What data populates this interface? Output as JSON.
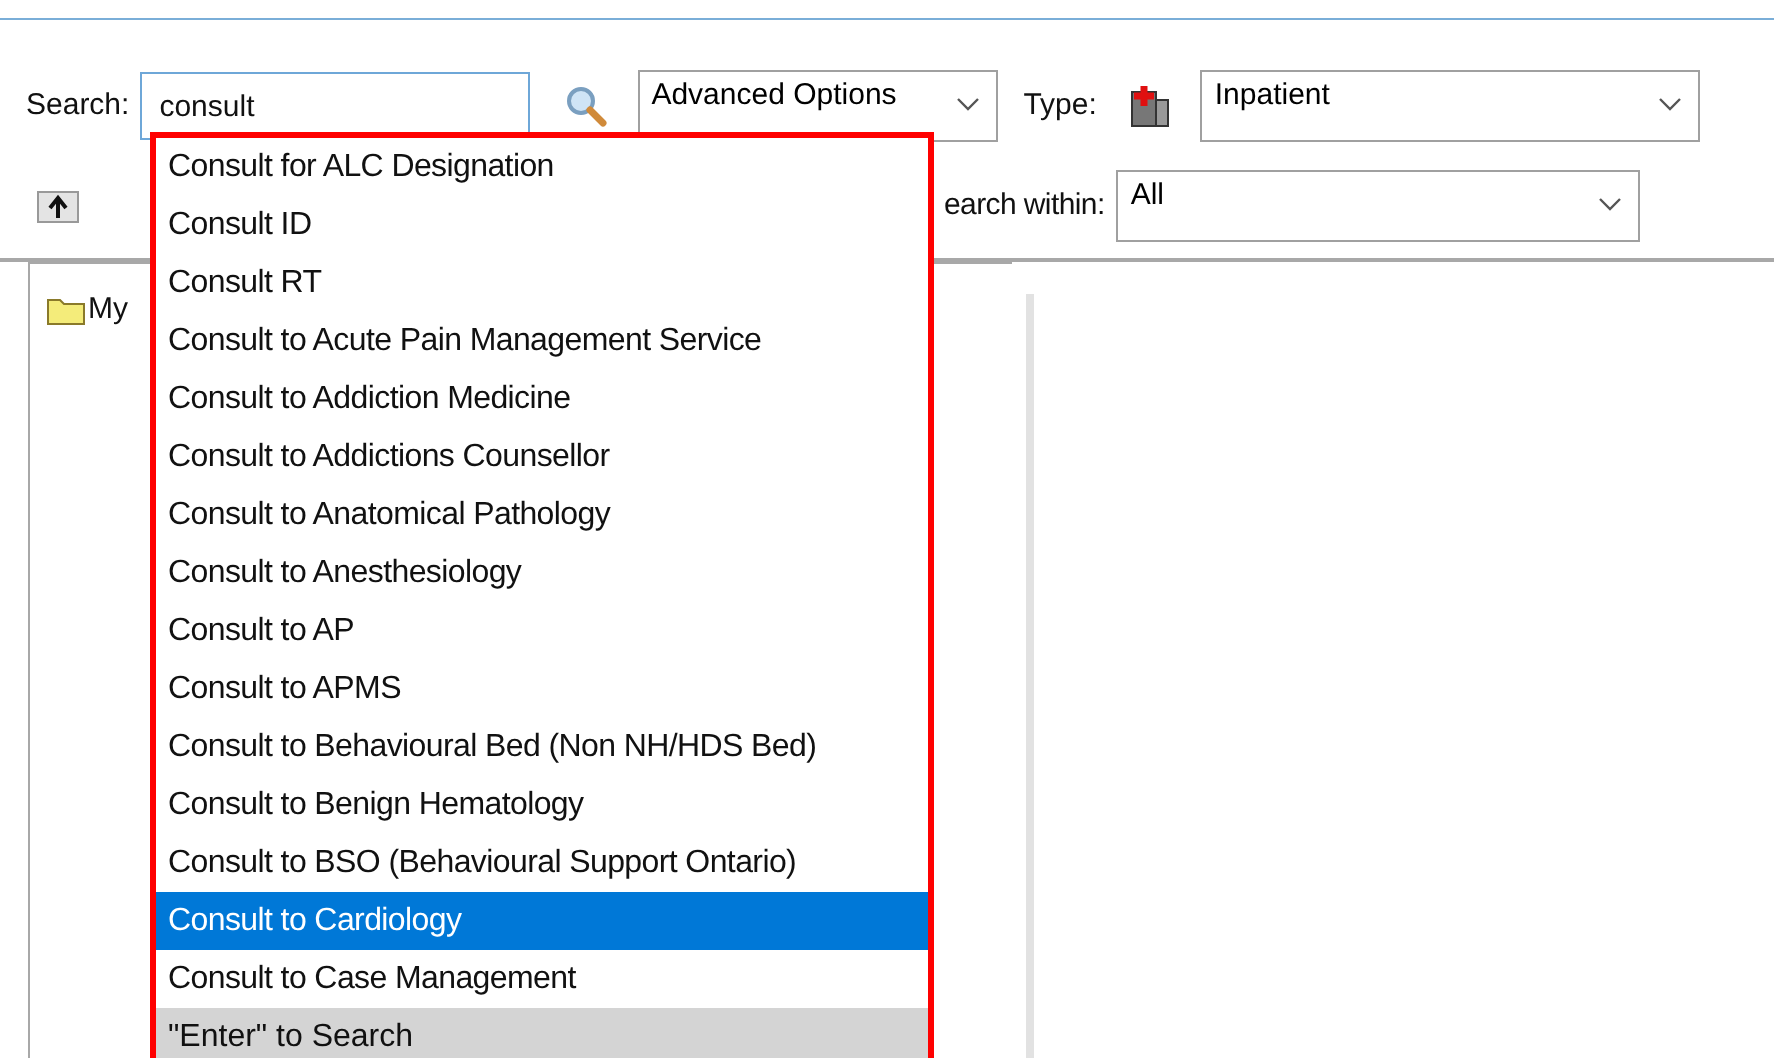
{
  "search": {
    "label": "Search:",
    "value": "consult"
  },
  "advanced_options": {
    "value": "Advanced Options"
  },
  "type": {
    "label": "Type:",
    "value": "Inpatient"
  },
  "search_within": {
    "label": "earch within:",
    "value": "All"
  },
  "tree": {
    "items": [
      {
        "label": "My"
      }
    ]
  },
  "suggestions": {
    "items": [
      {
        "label": "Consult for ALC Designation",
        "selected": false
      },
      {
        "label": "Consult ID",
        "selected": false
      },
      {
        "label": "Consult RT",
        "selected": false
      },
      {
        "label": "Consult to Acute Pain Management Service",
        "selected": false
      },
      {
        "label": "Consult to Addiction Medicine",
        "selected": false
      },
      {
        "label": "Consult to Addictions Counsellor",
        "selected": false
      },
      {
        "label": "Consult to Anatomical Pathology",
        "selected": false
      },
      {
        "label": "Consult to Anesthesiology",
        "selected": false
      },
      {
        "label": "Consult to AP",
        "selected": false
      },
      {
        "label": "Consult to APMS",
        "selected": false
      },
      {
        "label": "Consult to Behavioural Bed (Non NH/HDS Bed)",
        "selected": false
      },
      {
        "label": "Consult to Benign Hematology",
        "selected": false
      },
      {
        "label": "Consult to BSO (Behavioural Support Ontario)",
        "selected": false
      },
      {
        "label": "Consult to Cardiology",
        "selected": true
      },
      {
        "label": "Consult to Case Management",
        "selected": false
      }
    ],
    "footer": "\"Enter\" to Search"
  }
}
